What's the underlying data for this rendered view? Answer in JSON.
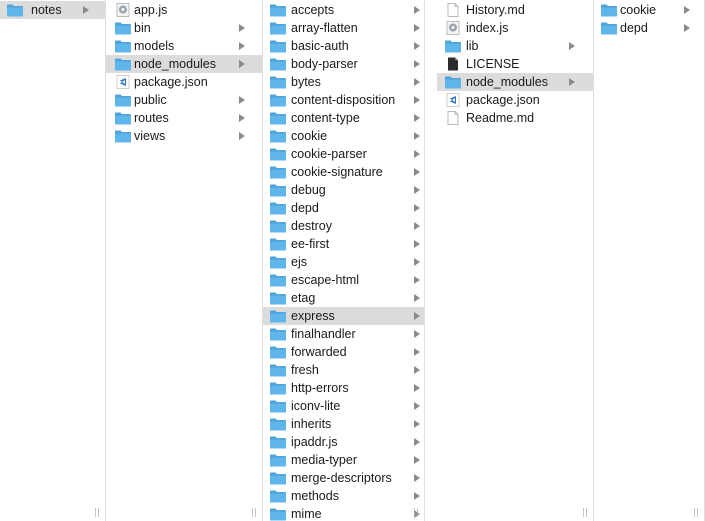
{
  "columns": [
    {
      "items": [
        {
          "label": "notes",
          "type": "folder",
          "arrow": true,
          "selected": true
        }
      ]
    },
    {
      "items": [
        {
          "label": "app.js",
          "type": "js",
          "arrow": false
        },
        {
          "label": "bin",
          "type": "folder",
          "arrow": true
        },
        {
          "label": "models",
          "type": "folder",
          "arrow": true
        },
        {
          "label": "node_modules",
          "type": "folder",
          "arrow": true,
          "selected": true
        },
        {
          "label": "package.json",
          "type": "vscode",
          "arrow": false
        },
        {
          "label": "public",
          "type": "folder",
          "arrow": true
        },
        {
          "label": "routes",
          "type": "folder",
          "arrow": true
        },
        {
          "label": "views",
          "type": "folder",
          "arrow": true
        }
      ]
    },
    {
      "items": [
        {
          "label": "accepts",
          "type": "folder",
          "arrow": true
        },
        {
          "label": "array-flatten",
          "type": "folder",
          "arrow": true
        },
        {
          "label": "basic-auth",
          "type": "folder",
          "arrow": true
        },
        {
          "label": "body-parser",
          "type": "folder",
          "arrow": true
        },
        {
          "label": "bytes",
          "type": "folder",
          "arrow": true
        },
        {
          "label": "content-disposition",
          "type": "folder",
          "arrow": true
        },
        {
          "label": "content-type",
          "type": "folder",
          "arrow": true
        },
        {
          "label": "cookie",
          "type": "folder",
          "arrow": true
        },
        {
          "label": "cookie-parser",
          "type": "folder",
          "arrow": true
        },
        {
          "label": "cookie-signature",
          "type": "folder",
          "arrow": true
        },
        {
          "label": "debug",
          "type": "folder",
          "arrow": true
        },
        {
          "label": "depd",
          "type": "folder",
          "arrow": true
        },
        {
          "label": "destroy",
          "type": "folder",
          "arrow": true
        },
        {
          "label": "ee-first",
          "type": "folder",
          "arrow": true
        },
        {
          "label": "ejs",
          "type": "folder",
          "arrow": true
        },
        {
          "label": "escape-html",
          "type": "folder",
          "arrow": true
        },
        {
          "label": "etag",
          "type": "folder",
          "arrow": true
        },
        {
          "label": "express",
          "type": "folder",
          "arrow": true,
          "selected": true
        },
        {
          "label": "finalhandler",
          "type": "folder",
          "arrow": true
        },
        {
          "label": "forwarded",
          "type": "folder",
          "arrow": true
        },
        {
          "label": "fresh",
          "type": "folder",
          "arrow": true
        },
        {
          "label": "http-errors",
          "type": "folder",
          "arrow": true
        },
        {
          "label": "iconv-lite",
          "type": "folder",
          "arrow": true
        },
        {
          "label": "inherits",
          "type": "folder",
          "arrow": true
        },
        {
          "label": "ipaddr.js",
          "type": "folder",
          "arrow": true
        },
        {
          "label": "media-typer",
          "type": "folder",
          "arrow": true
        },
        {
          "label": "merge-descriptors",
          "type": "folder",
          "arrow": true
        },
        {
          "label": "methods",
          "type": "folder",
          "arrow": true
        },
        {
          "label": "mime",
          "type": "folder",
          "arrow": true
        }
      ]
    },
    {
      "items": [
        {
          "label": "History.md",
          "type": "doc",
          "arrow": false
        },
        {
          "label": "index.js",
          "type": "js",
          "arrow": false
        },
        {
          "label": "lib",
          "type": "folder",
          "arrow": true
        },
        {
          "label": "LICENSE",
          "type": "blackdoc",
          "arrow": false
        },
        {
          "label": "node_modules",
          "type": "folder",
          "arrow": true,
          "selected": true
        },
        {
          "label": "package.json",
          "type": "vscode",
          "arrow": false
        },
        {
          "label": "Readme.md",
          "type": "doc",
          "arrow": false
        }
      ]
    },
    {
      "items": [
        {
          "label": "cookie",
          "type": "folder",
          "arrow": true
        },
        {
          "label": "depd",
          "type": "folder",
          "arrow": true
        }
      ]
    }
  ],
  "colors": {
    "folder": "#5fb6ea",
    "folder_tab": "#4ea3d8",
    "selected_row": "#dcdcdc",
    "arrow": "#8a8a8a",
    "vscode": "#2a73c8"
  },
  "resize_glyph": "||"
}
